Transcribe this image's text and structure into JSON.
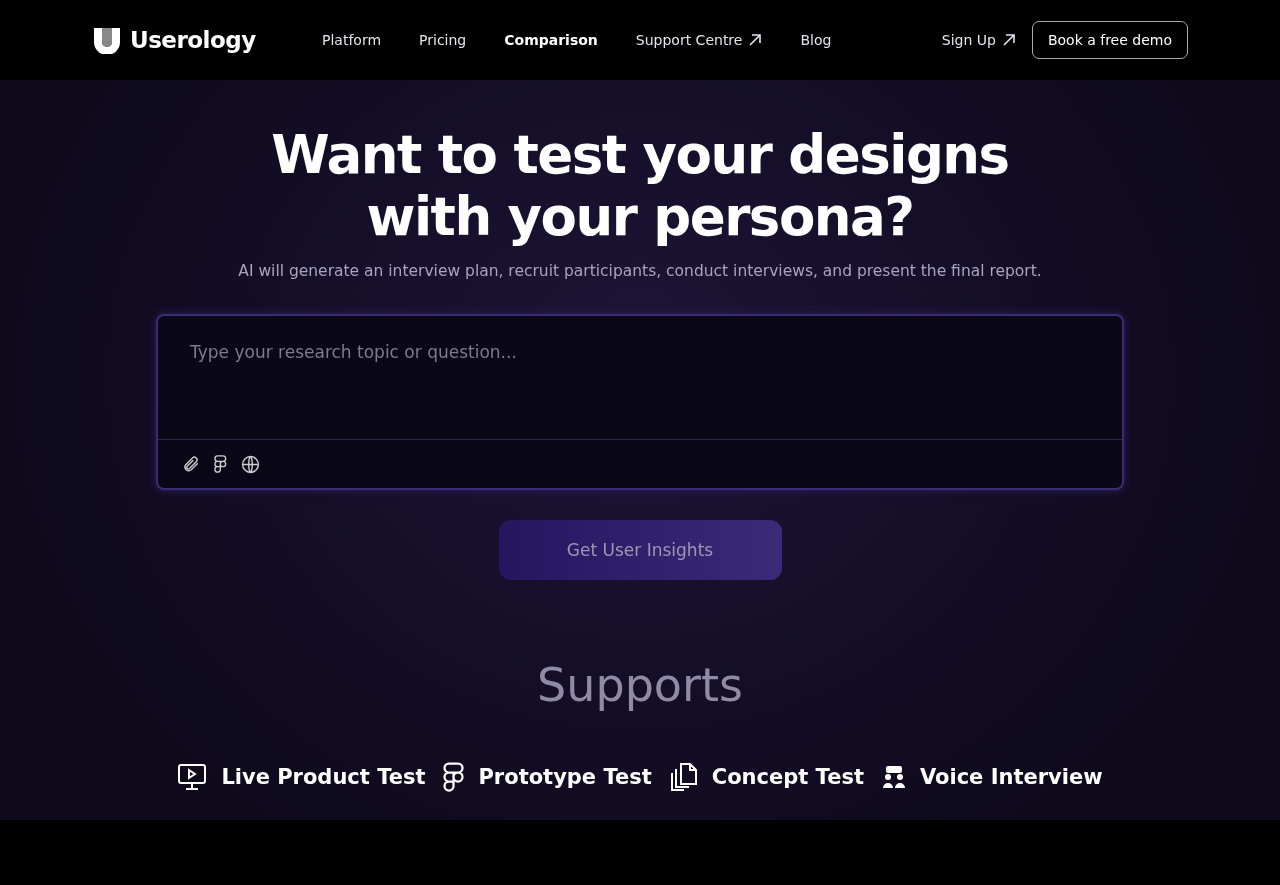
{
  "brand": {
    "name": "Userology"
  },
  "nav": [
    {
      "label": "Platform",
      "selected": false,
      "external": false
    },
    {
      "label": "Pricing",
      "selected": false,
      "external": false
    },
    {
      "label": "Comparison",
      "selected": true,
      "external": false
    },
    {
      "label": "Support Centre",
      "selected": false,
      "external": true
    },
    {
      "label": "Blog",
      "selected": false,
      "external": false
    }
  ],
  "auth": {
    "sign_up": "Sign Up",
    "demo": "Book a free demo"
  },
  "hero": {
    "title": "Want to test your designs with your persona?",
    "subtitle": "AI will generate an interview plan, recruit participants, conduct interviews, and present the final report."
  },
  "prompt": {
    "placeholder": "Type your research topic or question...",
    "tools": [
      {
        "kind": "attach"
      },
      {
        "kind": "figma"
      },
      {
        "kind": "globe"
      }
    ]
  },
  "cta": {
    "label": "Get User Insights",
    "disabled": true
  },
  "supports": {
    "title": "Supports",
    "items": [
      {
        "kind": "screen",
        "label": "Live Product Test"
      },
      {
        "kind": "figma",
        "label": "Prototype Test"
      },
      {
        "kind": "copies",
        "label": "Concept Test"
      },
      {
        "kind": "people",
        "label": "Voice Interview"
      }
    ]
  }
}
